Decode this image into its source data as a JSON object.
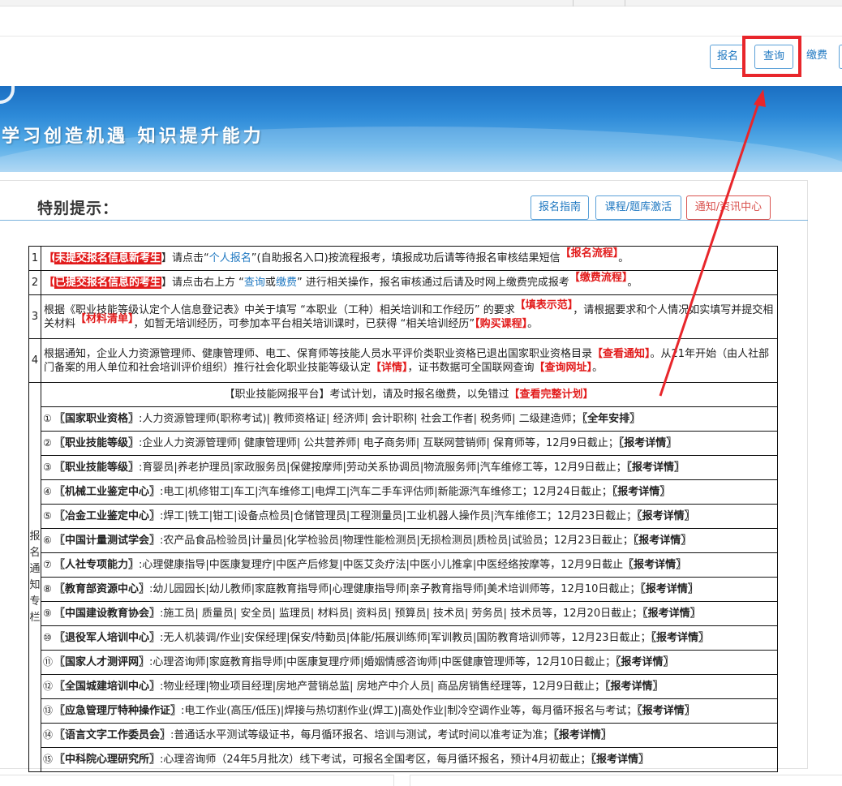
{
  "nav": {
    "buttons": [
      {
        "label": "报名"
      },
      {
        "label": "查询"
      },
      {
        "label": "缴费"
      }
    ]
  },
  "banner": {
    "slogan": "学习创造机遇  知识提升能力"
  },
  "panel": {
    "title": "特别提示：",
    "buttons": [
      {
        "label": "报名指南"
      },
      {
        "label": "课程/题库激活"
      },
      {
        "label": "通知/资讯中心"
      }
    ]
  },
  "notices": [
    {
      "num": "1",
      "tag": "未提交报名信息新考生",
      "t1": "】请点击“",
      "link1": "个人报名",
      "t2": "”(自助报名入口)按流程报考，填报成功后请等待报名审核结果短信",
      "rlink": "【报名流程】",
      "end": "。"
    },
    {
      "num": "2",
      "tag": "已提交报名信息的考生",
      "t1": "】请点击右上方 “",
      "link1": "查询",
      "mid": "或",
      "link2": "缴费",
      "t2": "” 进行相关操作，报名审核通过后请及时网上缴费完成报考",
      "rlink": "【缴费流程】",
      "end": "。"
    },
    {
      "num": "3",
      "t1": "根据《职业技能等级认定个人信息登记表》中关于填写 “本职业（工种）相关培训和工作经历” 的要求",
      "rlink1": "【填表示范】",
      "t2": "，请根据要求和个人情况如实填写并提交相关材料",
      "rlink2": "【材料清单】",
      "t3": "，如暂无培训经历，可参加本平台相关培训课时，已获得 “相关培训经历”",
      "rlink3": "【购买课程】",
      "end": "。"
    },
    {
      "num": "4",
      "t1": "根据通知，企业人力资源管理师、健康管理师、电工、保育师等技能人员水平评价类职业资格已退出国家职业资格目录",
      "rlink1": "【查看通知】",
      "t2": "。从21年开始（由人社部门备案的用人单位和社会培训评价组织）推行社会化职业技能等级认定",
      "rlink2": "【详情】",
      "t3": "，证书数据可全国联网查询",
      "rlink3": "【查询网址】",
      "end": "。"
    }
  ],
  "schedule": {
    "side_label": [
      "报",
      "名",
      "通",
      "知",
      "专",
      "栏"
    ],
    "header": {
      "pre": "【职业技能网报平台】考试计划，请及时报名缴费，以免错过",
      "link": "【查看完整计划】"
    },
    "items": [
      {
        "n": "①",
        "cat": "〖国家职业资格〗",
        "desc": ":人力资源管理师(职称考试)| 教师资格证| 经济师| 会计职称| 社会工作者|  税务师| 二级建造师；",
        "link": "〖全年安排〗"
      },
      {
        "n": "②",
        "cat": "〖职业技能等级〗",
        "desc": ":企业人力资源管理师| 健康管理师| 公共营养师| 电子商务师| 互联网营销师| 保育师等，12月9日截止；",
        "link": "〖报考详情〗"
      },
      {
        "n": "③",
        "cat": "〖职业技能等级〗",
        "desc": ":育婴员|养老护理员|家政服务员|保健按摩师|劳动关系协调员|物流服务师|汽车维修工等，12月9日截止；",
        "link": "〖报考详情〗"
      },
      {
        "n": "④",
        "cat": "〖机械工业鉴定中心〗",
        "desc": ":电工|机修钳工|车工|汽车维修工|电焊工|汽车二手车评估师|新能源汽车维修工；12月24日截止；",
        "link": "〖报考详情〗"
      },
      {
        "n": "⑤",
        "cat": "〖冶金工业鉴定中心〗",
        "desc": ":焊工|铣工|钳工|设备点检员|仓储管理员|工程测量员|工业机器人操作员|汽车维修工；12月23日截止；",
        "link": "〖报考详情〗"
      },
      {
        "n": "⑥",
        "cat": "〖中国计量测试学会〗",
        "desc": ":农产品食品检验员|计量员|化学检验员|物理性能检测员|无损检测员|质检员|试验员；12月23日截止；",
        "link": "〖报考详情〗"
      },
      {
        "n": "⑦",
        "cat": "〖人社专项能力〗",
        "desc": ":心理健康指导|中医康复理疗|中医产后修复|中医艾灸疗法|中医小儿推拿|中医经络按摩等，12月9日截止",
        "link": "〖报考详情〗"
      },
      {
        "n": "⑧",
        "cat": "〖教育部资源中心〗",
        "desc": ":幼儿园园长|幼儿教师|家庭教育指导师|心理健康指导师|亲子教育指导师|美术培训师等，12月10日截止；",
        "link": "〖报考详情〗"
      },
      {
        "n": "⑨",
        "cat": "〖中国建设教育协会〗",
        "desc": ":施工员| 质量员| 安全员| 监理员| 材料员| 资料员| 预算员| 技术员| 劳务员| 技术员等，12月20日截止；",
        "link": "〖报考详情〗"
      },
      {
        "n": "⑩",
        "cat": "〖退役军人培训中心〗",
        "desc": ":无人机装调/作业|安保经理|保安/特勤员|体能/拓展训练师|军训教员|国防教育培训师等，12月23日截止；",
        "link": "〖报考详情〗"
      },
      {
        "n": "⑪",
        "cat": "〖国家人才测评网〗",
        "desc": ":心理咨询师|家庭教育指导师|中医康复理疗师|婚姻情感咨询师|中医健康管理师等，12月10日截止；",
        "link": "〖报考详情〗"
      },
      {
        "n": "⑫",
        "cat": "〖全国城建培训中心〗",
        "desc": ":物业经理|物业项目经理|房地产营销总监| 房地产中介人员| 商品房销售经理等，12月9日截止；",
        "link": "〖报考详情〗"
      },
      {
        "n": "⑬",
        "cat": "〖应急管理厅特种操作证〗",
        "desc": ":电工作业(高压/低压)|焊接与热切割作业(焊工)|高处作业|制冷空调作业等，每月循环报名与考试；",
        "link": "〖报考详情〗"
      },
      {
        "n": "⑭",
        "cat": "〖语言文字工作委员会〗",
        "desc": ":普通话水平测试等级证书，每月循环报名、培训与测试，考试时间以准考证为准；",
        "link": "〖报考详情〗"
      },
      {
        "n": "⑮",
        "cat": "〖中科院心理研究所〗",
        "desc": ":心理咨询师（24年5月批次）线下考试，可报名全国考区，每月循环报名，预计4月初截止；",
        "link": "〖报考详情〗"
      }
    ]
  }
}
